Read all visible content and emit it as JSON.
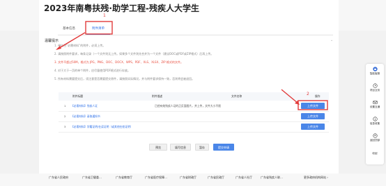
{
  "page": {
    "title": "2023年南粤扶残·助学工程-残疾人大学生"
  },
  "tabs": [
    {
      "label": "基本信息"
    },
    {
      "label": "附件清单"
    }
  ],
  "notice": {
    "title": "温馨提示",
    "lines": [
      "1. 带红色“必需材料”的附件，必须上传。",
      "2. 请按照附件要求，每条记录（一个文件则无上传。如果多个文件则先合并为一个文件（建议DOC或PDF或ZIP格式）后再上传。",
      "3. 文件不超过50M，格式为 JPG、PNG、DOC、DOCX、WPS、PDF、XLS、XLSX、ZIP 格式的文件。",
      "4. 对于大于一页的单个附件，应尽量使用PDF格式进行存放。",
      "5. 所有材料需要提交后，须注意是否需要提交原件，请按照实际情况，并与附件要求保持一致，否则将会被退回。"
    ]
  },
  "table": {
    "headers": [
      "附件标题",
      "附件描述",
      "文件名称",
      "操作"
    ],
    "rows": [
      {
        "num": "1",
        "title_prefix": "【必需材料】",
        "title": "残疾人证",
        "desc": "已经有效残疾人证的正反面图片，并上传，文件大小不限",
        "button": "上传文件"
      },
      {
        "num": "2",
        "title_prefix": "【必需材料】",
        "title": "录取通知书",
        "desc": "",
        "button": "上传文件"
      },
      {
        "num": "3",
        "title_prefix": "【必需材料】",
        "title": "学籍证明/在读证明（或其他在校证明）",
        "desc": "",
        "button": "上传文件"
      }
    ]
  },
  "actions": {
    "preview": "预览",
    "prev": "填写信息",
    "save": "暂存",
    "submit": "提交申请"
  },
  "annotations": {
    "label1": "1",
    "label2": "2"
  },
  "footer": {
    "links": [
      "广东省人民政府",
      "广东省卫健委…",
      "广东省教育厅",
      "广东省医疗保障…",
      "广东省财政厅",
      "广东省民政厅",
      "广东省人社厅",
      "广东省残疾人联…",
      "更多政府机构网站 ›"
    ]
  },
  "sidebar": {
    "items": [
      {
        "label": "智能客服",
        "icon": "robot-icon"
      },
      {
        "label": "项目业务",
        "icon": "clock-icon"
      },
      {
        "label": "设置互通",
        "icon": "mail-icon"
      },
      {
        "label": "信息收集",
        "icon": "info-icon"
      },
      {
        "label": "返回顶部",
        "icon": "arrow-up-icon"
      },
      {
        "label": "收起",
        "icon": "collapse-icon"
      }
    ]
  },
  "colors": {
    "accent": "#2c6fe8",
    "primary_button": "#4a86e8",
    "annotation": "#e23b3b"
  }
}
